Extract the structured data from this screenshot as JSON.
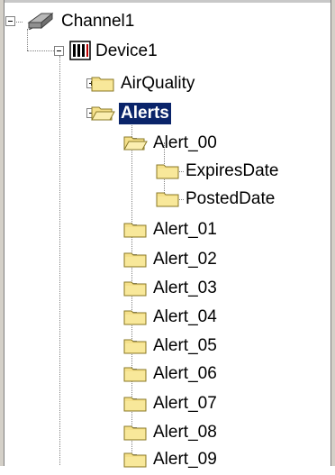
{
  "tree": {
    "channel": {
      "label": "Channel1",
      "icon": "channel-plug-icon"
    },
    "device": {
      "label": "Device1",
      "icon": "device-icon"
    },
    "groups": [
      {
        "label": "AirQuality",
        "expanded": false,
        "selected": false
      },
      {
        "label": "Alerts",
        "expanded": true,
        "selected": true
      },
      {
        "label": "Alert_00",
        "expanded": true,
        "selected": false
      },
      {
        "label": "ExpiresDate"
      },
      {
        "label": "PostedDate"
      },
      {
        "label": "Alert_01",
        "expanded": false
      },
      {
        "label": "Alert_02",
        "expanded": false
      },
      {
        "label": "Alert_03",
        "expanded": false
      },
      {
        "label": "Alert_04",
        "expanded": false
      },
      {
        "label": "Alert_05",
        "expanded": false
      },
      {
        "label": "Alert_06",
        "expanded": false
      },
      {
        "label": "Alert_07",
        "expanded": false
      },
      {
        "label": "Alert_08",
        "expanded": false
      },
      {
        "label": "Alert_09",
        "expanded": false
      }
    ]
  },
  "colors": {
    "selection": "#0a246a",
    "folder": "#f5e08a",
    "folder_edge": "#8a7a28"
  }
}
